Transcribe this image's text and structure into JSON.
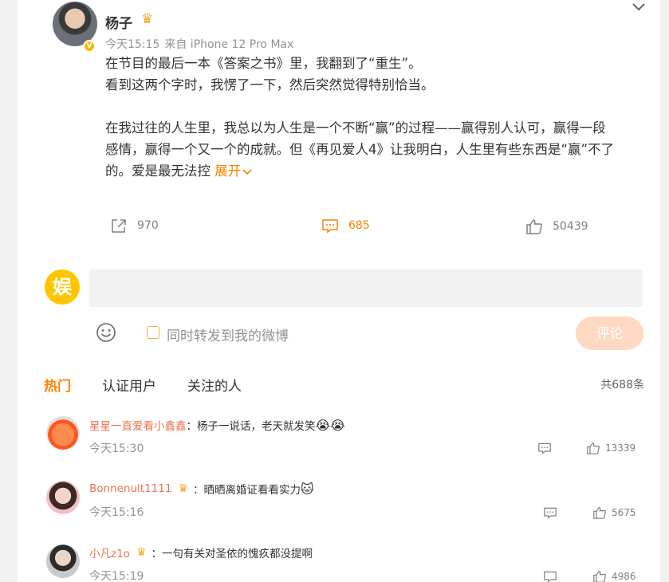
{
  "post": {
    "author": "杨子",
    "time": "今天15:15",
    "source": "来自 iPhone 12 Pro Max",
    "line1": "在节目的最后一本《答案之书》里，我翻到了“重生”。",
    "line2": "看到这两个字时，我愣了一下，然后突然觉得特别恰当。",
    "line3": "在我过往的人生里，我总以为人生是一个不断“赢”的过程——赢得别人认可，赢得一段",
    "line4": "感情，赢得一个又一个的成就。但《再见爱人4》让我明白，人生里有些东西是“赢”不了",
    "line5": "的。爱是最无法控",
    "expand_label": "展开",
    "shares": "970",
    "comments": "685",
    "likes": "50439"
  },
  "composer": {
    "logo_text": "娱",
    "placeholder": "",
    "repost_label": "同时转发到我的微博",
    "submit_label": "评论"
  },
  "tabs": {
    "hot": "热门",
    "verified": "认证用户",
    "following": "关注的人",
    "total": "共688条"
  },
  "comments": [
    {
      "user": "星星一直爱看小鑫鑫",
      "sep": "：",
      "text": "杨子一说话，老天就发笑",
      "emoji": "😭😭",
      "time": "今天15:30",
      "likes": "13339"
    },
    {
      "user": "Bonnenult1111",
      "sep": "：",
      "text": "晒晒离婚证看看实力",
      "emoji": "🐱",
      "time": "今天15:16",
      "likes": "5675"
    },
    {
      "user": "小凡z1o",
      "sep": "：",
      "text": "一句有关对圣依的愧疚都没提啊",
      "emoji": "",
      "time": "今天15:19",
      "likes": "4986"
    }
  ],
  "colors": {
    "accent": "#ff8200",
    "username_link": "#eb7350",
    "submit_disabled": "#ffd9c2"
  },
  "icons": [
    "chevron-down-icon",
    "share-icon",
    "comment-icon",
    "like-icon",
    "emoji-icon",
    "crown-icon",
    "verified-icon"
  ]
}
